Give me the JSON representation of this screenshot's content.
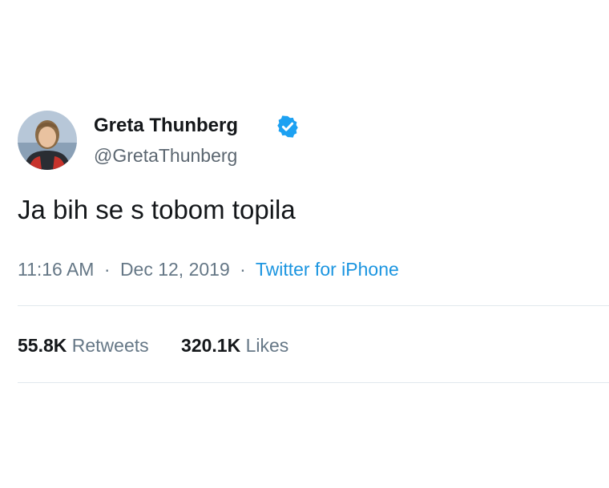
{
  "tweet": {
    "author": {
      "display_name": "Greta Thunberg",
      "handle": "@GretaThunberg",
      "verified": true,
      "verified_icon": "verified-badge-icon",
      "verified_color": "#1da1f2"
    },
    "text": "Ja bih se s tobom topila",
    "meta": {
      "time": "11:16 AM",
      "date": "Dec 12, 2019",
      "source": "Twitter for iPhone",
      "separator": "·",
      "source_color": "#1b95e0"
    },
    "stats": {
      "retweets_count": "55.8K",
      "retweets_label": "Retweets",
      "likes_count": "320.1K",
      "likes_label": "Likes"
    }
  }
}
